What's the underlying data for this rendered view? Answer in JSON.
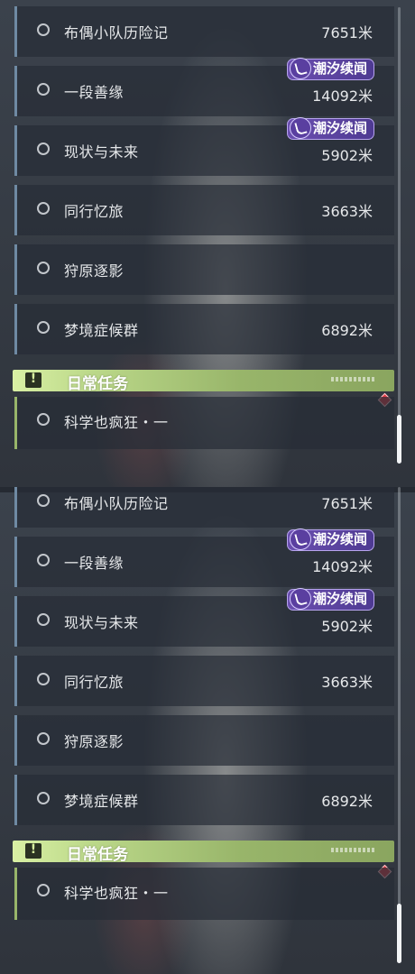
{
  "panels": [
    {
      "quests": [
        {
          "name": "布偶小队历险记",
          "distance": "7651米",
          "badge": ""
        },
        {
          "name": "一段善缘",
          "distance": "14092米",
          "badge": "潮汐续闻"
        },
        {
          "name": "现状与未来",
          "distance": "5902米",
          "badge": "潮汐续闻"
        },
        {
          "name": "同行忆旅",
          "distance": "3663米",
          "badge": ""
        },
        {
          "name": "狩原逐影",
          "distance": "",
          "badge": ""
        },
        {
          "name": "梦境症候群",
          "distance": "6892米",
          "badge": ""
        }
      ],
      "daily_section": {
        "title": "日常任务",
        "quests": [
          {
            "name": "科学也疯狂・一"
          }
        ]
      }
    },
    {
      "quests": [
        {
          "name": "布偶小队历险记",
          "distance": "7651米",
          "badge": ""
        },
        {
          "name": "一段善缘",
          "distance": "14092米",
          "badge": "潮汐续闻"
        },
        {
          "name": "现状与未来",
          "distance": "5902米",
          "badge": "潮汐续闻"
        },
        {
          "name": "同行忆旅",
          "distance": "3663米",
          "badge": ""
        },
        {
          "name": "狩原逐影",
          "distance": "",
          "badge": ""
        },
        {
          "name": "梦境症候群",
          "distance": "6892米",
          "badge": ""
        }
      ],
      "daily_section": {
        "title": "日常任务",
        "quests": [
          {
            "name": "科学也疯狂・一"
          }
        ]
      }
    }
  ],
  "colors": {
    "quest_accent": "#6f8aa3",
    "daily_accent": "#98b56a",
    "badge_purple": "#6b4fb0",
    "marker_red": "#e23b45"
  },
  "icons": {
    "radio": "radio-circle-icon",
    "badge": "tide-badge-icon",
    "warning": "exclamation-icon",
    "marker": "red-diamond-icon"
  }
}
